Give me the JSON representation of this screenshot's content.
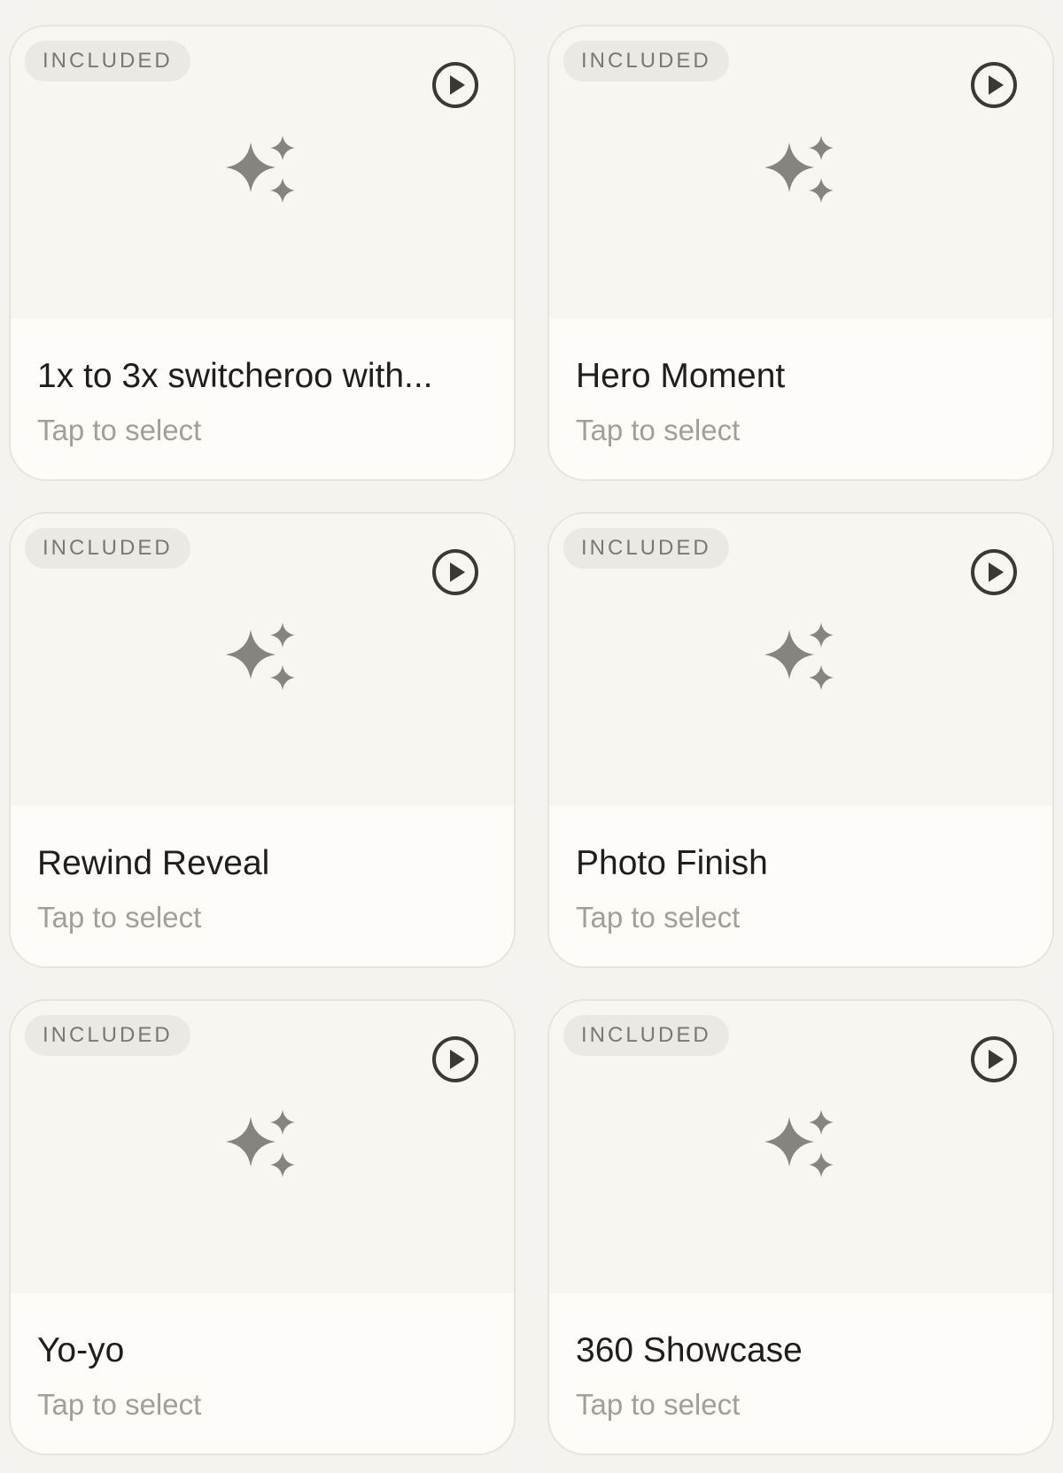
{
  "cards": [
    {
      "badge": "INCLUDED",
      "title": "1x to 3x switcheroo with...",
      "subtitle": "Tap to select"
    },
    {
      "badge": "INCLUDED",
      "title": "Hero Moment",
      "subtitle": "Tap to select"
    },
    {
      "badge": "INCLUDED",
      "title": "Rewind Reveal",
      "subtitle": "Tap to select"
    },
    {
      "badge": "INCLUDED",
      "title": "Photo Finish",
      "subtitle": "Tap to select"
    },
    {
      "badge": "INCLUDED",
      "title": "Yo-yo",
      "subtitle": "Tap to select"
    },
    {
      "badge": "INCLUDED",
      "title": "360 Showcase",
      "subtitle": "Tap to select"
    }
  ],
  "icons": {
    "play": "play-circle-icon",
    "thumbnail": "sparkles-icon"
  },
  "colors": {
    "background": "#f4f3f0",
    "card": "#fdfcf9",
    "icon": "#85847f",
    "play": "#3a3936"
  }
}
